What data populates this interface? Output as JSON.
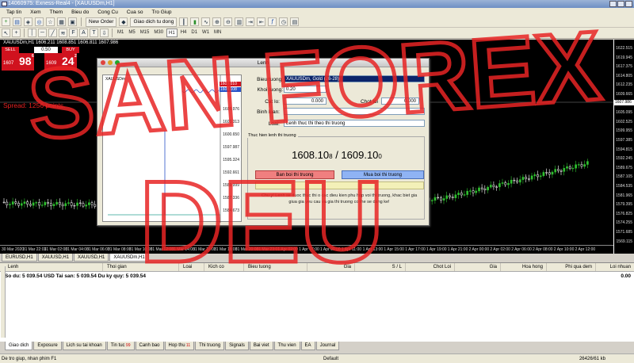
{
  "window": {
    "title": "14060975: Exness-Real4 - [XAUUSDm,H1]"
  },
  "menu": [
    "Tap tin",
    "Xem",
    "Them",
    "Bieu do",
    "Cong Cu",
    "Cua so",
    "Tro Giup"
  ],
  "toolbar": {
    "new_order": "New Order",
    "auto_trading": "Giao dich tu dong"
  },
  "timeframes": [
    "M1",
    "M5",
    "M15",
    "M30",
    "H1",
    "H4",
    "D1",
    "W1",
    "MN"
  ],
  "active_timeframe": "H1",
  "chart": {
    "symbol_title": "XAUUSDm,H1  1606.211 1608.851 1606.811 1607.986",
    "sell_label": "SELL",
    "buy_label": "BUY",
    "lot": "0.50",
    "bid_small": "1607",
    "bid_big": "98",
    "bid_sup": "6",
    "ask_small": "1609",
    "ask_big": "24",
    "ask_sup": "2",
    "spread_text": "Spread: 1256 points.",
    "current_price": "1607.986",
    "price_labels": [
      "1622.515",
      "1619.945",
      "1617.375",
      "1614.805",
      "1612.235",
      "1609.665",
      "1607.986",
      "1605.095",
      "1602.525",
      "1599.955",
      "1597.385",
      "1594.815",
      "1592.245",
      "1589.675",
      "1587.105",
      "1584.535",
      "1581.965",
      "1579.395",
      "1576.825",
      "1574.255",
      "1571.685",
      "1569.115"
    ],
    "time_labels": [
      "30 Mar 2020",
      "31 Mar 22:01",
      "31 Mar 02:00",
      "31 Mar 04:00",
      "31 Mar 06:00",
      "31 Mar 08:00",
      "31 Mar 10:00",
      "31 Mar 12:00",
      "31 Mar 14:00",
      "31 Mar 16:00",
      "31 Mar 18:00",
      "31 Mar 20:00",
      "31 Mar 23:01",
      "1 Apr 02:00",
      "1 Apr 07:00",
      "1 Apr 09:00",
      "1 Apr 11:00",
      "1 Apr 13:00",
      "1 Apr 15:00",
      "1 Apr 17:00",
      "1 Apr 19:00",
      "1 Apr 21:00",
      "2 Apr 00:00",
      "2 Apr 02:00",
      "2 Apr 06:00",
      "2 Apr 08:00",
      "2 Apr 10:00",
      "2 Apr 12:00"
    ]
  },
  "chart_tabs": [
    "EURUSD,H1",
    "XAUUSD,H1",
    "XAUUSD,H1",
    "XAUUSDm,H1"
  ],
  "active_chart_tab": 3,
  "dialog": {
    "title": "Lenh",
    "mini_title": "XAUUSDm",
    "mini_prices": [
      "1609.010",
      "1608.108",
      "1605.976",
      "1603.313",
      "1600.650",
      "1597.987",
      "1595.324",
      "1592.661",
      "1589.999",
      "1587.336",
      "1584.673"
    ],
    "symbol_label": "Bieu tuong:",
    "symbol_value": "XAUUSDm, Gold (26-28)",
    "volume_label": "Khoi luong:",
    "volume_value": "0.20",
    "sl_label": "Cat lo:",
    "sl_value": "0.000",
    "tp_label": "Chot loi",
    "tp_value": "0.000",
    "comment_label": "Binh luan:",
    "type_label": "Loai:",
    "type_value": "Lenh thuc thi theo thi truong",
    "exec_legend": "Thuc hien lenh thi truong",
    "bid": "1608.10",
    "bid_sup": "8",
    "ask": "1609.10",
    "ask_sup": "0",
    "sell_button": "Ban boi thi truong",
    "buy_button": "Mua boi thi truong",
    "note": "Chu y! Lenh se duoc thuc thi o cac dieu kien phu hop voi thi truong, khac biet gia giua gia yeu cau va gia thi truong co the se dang ke!"
  },
  "terminal": {
    "columns": [
      "Lenh",
      "Thoi gian",
      "Loai",
      "Kich co",
      "Bieu tuong",
      "Gia",
      "S / L",
      "Chot Loi",
      "Gia",
      "Hoa hong",
      "Phi qua dem",
      "Loi nhuan"
    ],
    "balance_row": "So du: 5 039.54 USD  Tai san: 5 039.54  Du ky quy: 5 039.54",
    "balance_value": "0.00"
  },
  "terminal_tabs": [
    {
      "label": "Giao dich",
      "badge": ""
    },
    {
      "label": "Exposure",
      "badge": ""
    },
    {
      "label": "Lich su tai khoan",
      "badge": ""
    },
    {
      "label": "Tin tuc",
      "badge": "99"
    },
    {
      "label": "Canh bao",
      "badge": ""
    },
    {
      "label": "Hop thu",
      "badge": "11"
    },
    {
      "label": "Thi truong",
      "badge": ""
    },
    {
      "label": "Signals",
      "badge": ""
    },
    {
      "label": "Bai viet",
      "badge": ""
    },
    {
      "label": "Thu vien",
      "badge": ""
    },
    {
      "label": "EA",
      "badge": ""
    },
    {
      "label": "Journal",
      "badge": ""
    }
  ],
  "status": {
    "help": "De tro giup, nhan phim F1",
    "profile": "Default",
    "traffic": "26426/61 kb"
  },
  "watermark": {
    "line1": "SAN FOREX",
    "line2": "DEU"
  },
  "colors": {
    "sell": "#d0121e",
    "watermark": "#e82424",
    "bull": "#2fbf2f",
    "bear": "#ffffff"
  }
}
